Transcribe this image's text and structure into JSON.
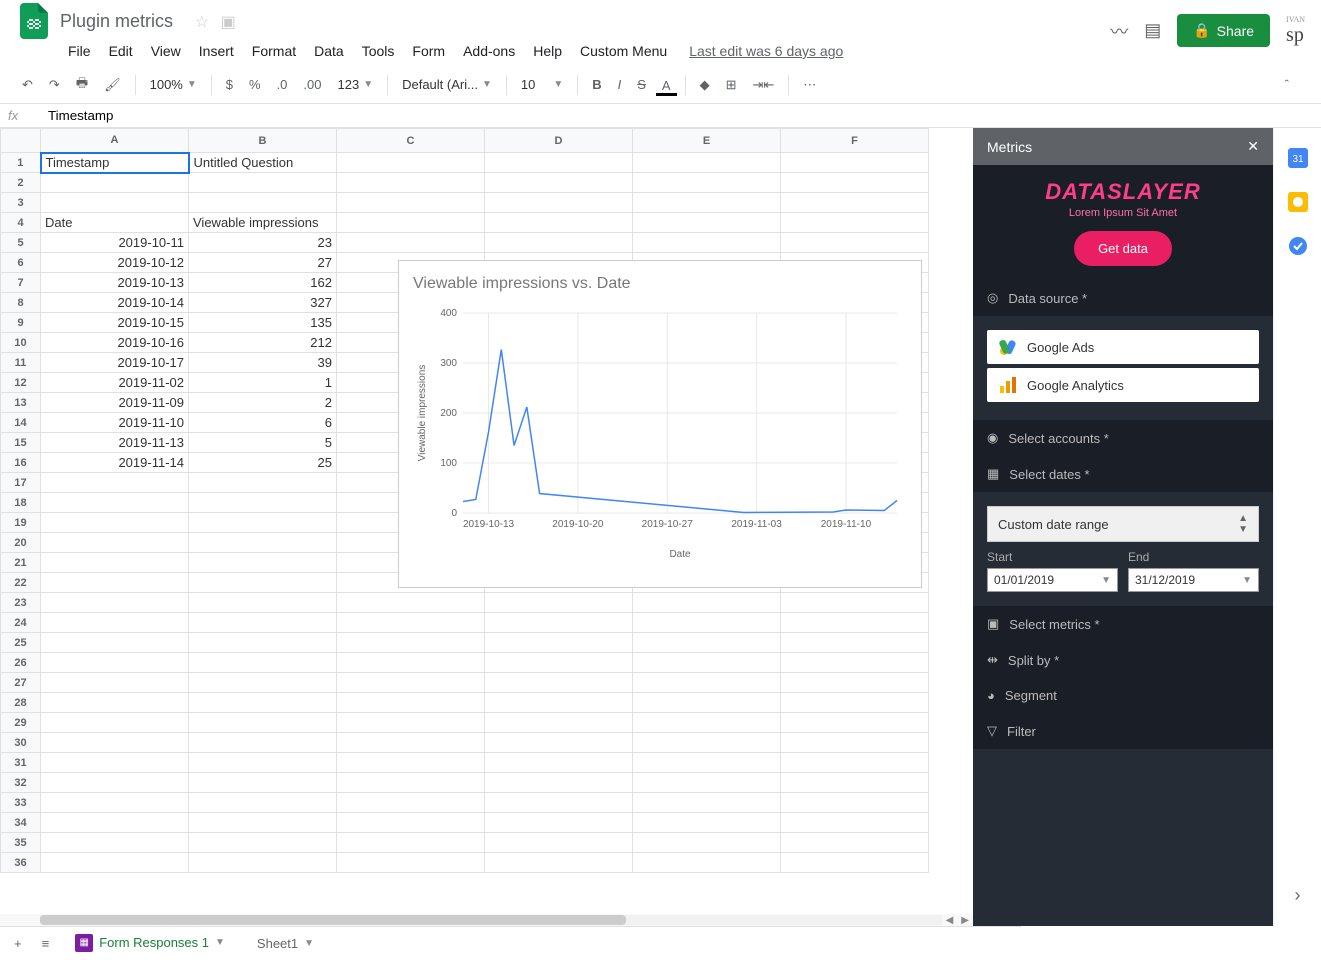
{
  "doc_title": "Plugin metrics",
  "last_edit": "Last edit was 6 days ago",
  "menu": [
    "File",
    "Edit",
    "View",
    "Insert",
    "Format",
    "Data",
    "Tools",
    "Form",
    "Add-ons",
    "Help",
    "Custom Menu"
  ],
  "share_label": "Share",
  "zoom": "100%",
  "font_name": "Default (Ari...",
  "font_size": "10",
  "formula_cell_value": "Timestamp",
  "columns": [
    "A",
    "B",
    "C",
    "D",
    "E",
    "F"
  ],
  "row_numbers": [
    1,
    2,
    3,
    4,
    5,
    6,
    7,
    8,
    9,
    10,
    11,
    12,
    13,
    14,
    15,
    16,
    17,
    18,
    19,
    20,
    21,
    22,
    23,
    24,
    25,
    26,
    27,
    28,
    29,
    30,
    31,
    32,
    33,
    34,
    35,
    36
  ],
  "cells": {
    "A1": "Timestamp",
    "B1": "Untitled Question",
    "A4": "Date",
    "B4": "Viewable impressions",
    "A5": "2019-10-11",
    "B5": "23",
    "A6": "2019-10-12",
    "B6": "27",
    "A7": "2019-10-13",
    "B7": "162",
    "A8": "2019-10-14",
    "B8": "327",
    "A9": "2019-10-15",
    "B9": "135",
    "A10": "2019-10-16",
    "B10": "212",
    "A11": "2019-10-17",
    "B11": "39",
    "A12": "2019-11-02",
    "B12": "1",
    "A13": "2019-11-09",
    "B13": "2",
    "A14": "2019-11-10",
    "B14": "6",
    "A15": "2019-11-13",
    "B15": "5",
    "A16": "2019-11-14",
    "B16": "25"
  },
  "chart": {
    "title": "Viewable impressions vs. Date",
    "xlabel": "Date",
    "ylabel": "Viewable impressions"
  },
  "chart_data": {
    "type": "line",
    "title": "Viewable impressions vs. Date",
    "xlabel": "Date",
    "ylabel": "Viewable impressions",
    "categories": [
      "2019-10-11",
      "2019-10-12",
      "2019-10-13",
      "2019-10-14",
      "2019-10-15",
      "2019-10-16",
      "2019-10-17",
      "2019-11-02",
      "2019-11-09",
      "2019-11-10",
      "2019-11-13",
      "2019-11-14"
    ],
    "values": [
      23,
      27,
      162,
      327,
      135,
      212,
      39,
      1,
      2,
      6,
      5,
      25
    ],
    "x_ticks": [
      "2019-10-13",
      "2019-10-20",
      "2019-10-27",
      "2019-11-03",
      "2019-11-10"
    ],
    "y_ticks": [
      0,
      100,
      200,
      300,
      400
    ],
    "ylim": [
      0,
      400
    ]
  },
  "sheet_tabs": [
    {
      "name": "Form Responses 1",
      "active": true
    },
    {
      "name": "Sheet1",
      "active": false
    }
  ],
  "panel": {
    "title": "Metrics",
    "brand": "DATASLAYER",
    "brand_sub": "Lorem Ipsum Sit Amet",
    "get_data": "Get data",
    "sections": {
      "datasource": "Data source *",
      "accounts": "Select accounts *",
      "dates": "Select dates *",
      "metrics": "Select metrics *",
      "splitby": "Split by *",
      "segment": "Segment",
      "filter": "Filter"
    },
    "datasources": [
      "Google Ads",
      "Google Analytics"
    ],
    "date_range_label": "Custom date range",
    "start_label": "Start",
    "end_label": "End",
    "start_value": "01/01/2019",
    "end_value": "31/12/2019"
  }
}
